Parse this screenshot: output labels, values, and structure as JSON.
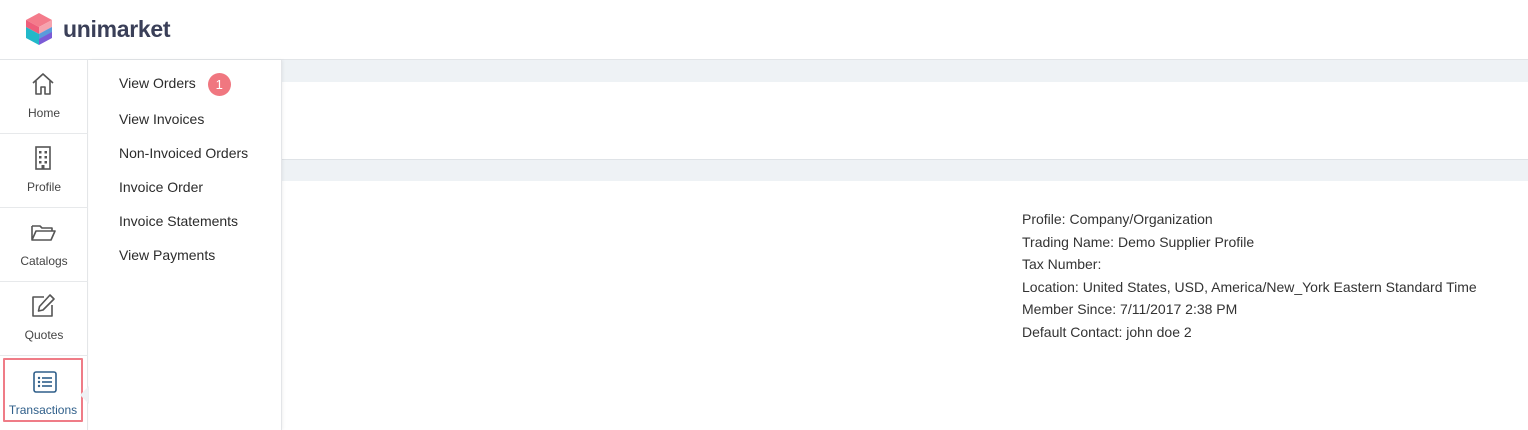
{
  "header": {
    "brand": "unimarket"
  },
  "rail": {
    "items": [
      {
        "label": "Home",
        "icon": "home-icon"
      },
      {
        "label": "Profile",
        "icon": "building-icon"
      },
      {
        "label": "Catalogs",
        "icon": "folder-icon"
      },
      {
        "label": "Quotes",
        "icon": "edit-icon"
      },
      {
        "label": "Transactions",
        "icon": "list-icon",
        "active": true
      }
    ]
  },
  "flyout": {
    "items": [
      {
        "label": "View Orders",
        "badge": "1"
      },
      {
        "label": "View Invoices"
      },
      {
        "label": "Non-Invoiced Orders"
      },
      {
        "label": "Invoice Order"
      },
      {
        "label": "Invoice Statements"
      },
      {
        "label": "View Payments"
      }
    ]
  },
  "profile_info": {
    "profile": "Profile: Company/Organization",
    "trading_name": "Trading Name: Demo Supplier Profile",
    "tax_number": "Tax Number:",
    "location": "Location: United States, USD, America/New_York Eastern Standard Time",
    "member_since": "Member Since: 7/11/2017 2:38 PM",
    "default_contact": "Default Contact: john doe 2"
  },
  "colors": {
    "accent": "#f07780",
    "active_border": "#ef7c87",
    "link": "#2f6fae",
    "brand_text": "#3a3f58"
  }
}
